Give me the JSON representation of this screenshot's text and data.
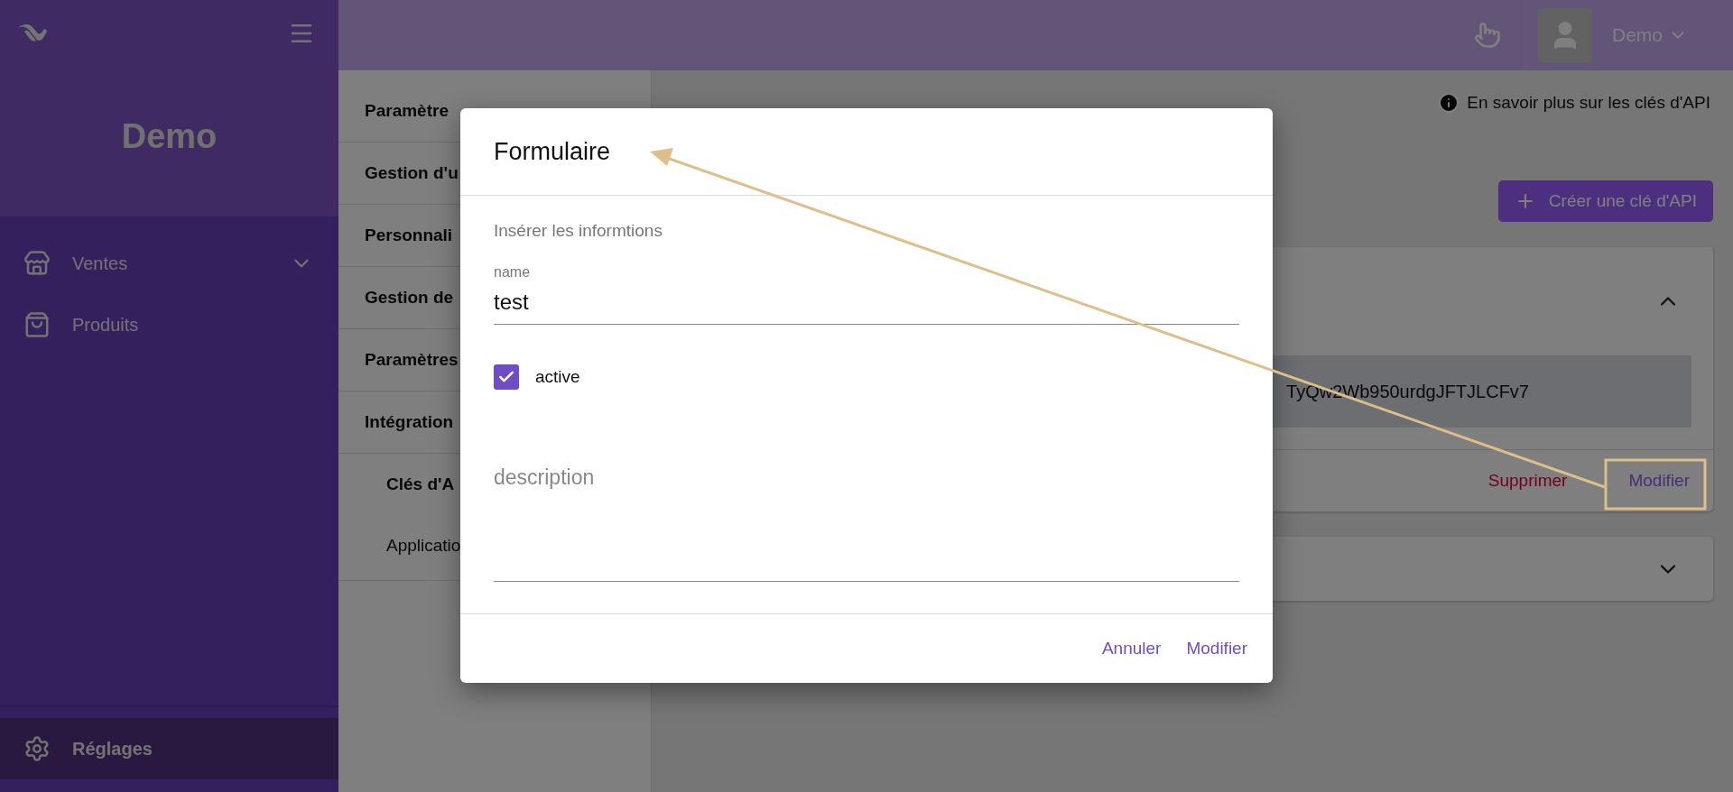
{
  "sidebar": {
    "title": "Demo",
    "items": [
      {
        "label": "Ventes",
        "expanded": false
      },
      {
        "label": "Produits"
      }
    ],
    "footer_item": {
      "label": "Réglages",
      "selected": true
    }
  },
  "header": {
    "user": "Demo"
  },
  "settings_nav": {
    "items": [
      {
        "label": "Paramètre"
      },
      {
        "label": "Gestion d'u"
      },
      {
        "label": "Personnali"
      },
      {
        "label": "Gestion de"
      },
      {
        "label": "Paramètres"
      },
      {
        "label": "Intégration",
        "children": [
          {
            "label": "Clés d'A",
            "selected": true
          },
          {
            "label": "Applicatio",
            "selected": false
          }
        ]
      }
    ]
  },
  "main": {
    "help_link": "En savoir plus sur les clés d'API",
    "create_button": "Créer une clé d'API",
    "cards": [
      {
        "expanded": true,
        "key": "TyQw2Wb950urdgJFTJLCFv7",
        "actions": [
          {
            "label": "Supprimer",
            "kind": "danger"
          },
          {
            "label": "Modifier",
            "kind": "primary"
          }
        ]
      },
      {
        "expanded": false
      }
    ]
  },
  "dialog": {
    "title": "Formulaire",
    "subtitle": "Insérer les informtions",
    "fields": [
      {
        "kind": "text",
        "label": "name",
        "value": "test"
      },
      {
        "kind": "checkbox",
        "label": "active",
        "checked": true
      },
      {
        "kind": "textarea",
        "placeholder": "description"
      }
    ],
    "buttons": [
      "Annuler",
      "Modifier"
    ]
  }
}
